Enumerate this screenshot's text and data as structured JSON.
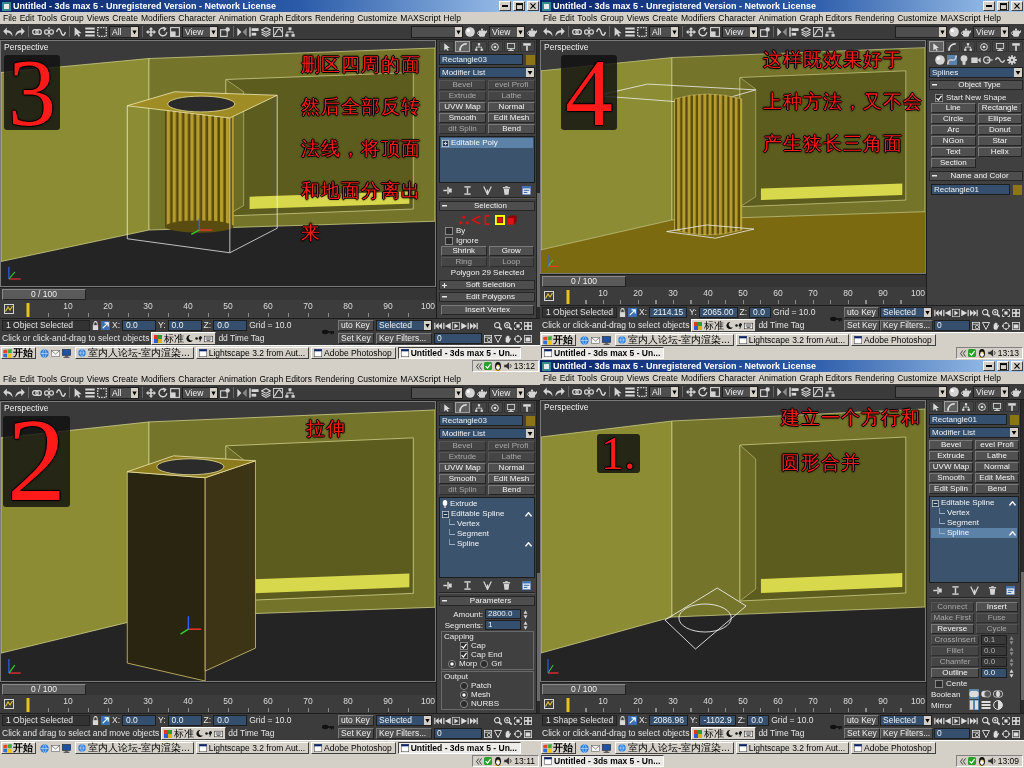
{
  "windows": [
    {
      "title": "Untitled - 3ds max 5 - Unregistered Version - Network License",
      "menu": [
        "File",
        "Edit",
        "Tools",
        "Group",
        "Views",
        "Create",
        "Modifiers",
        "Character",
        "Animation",
        "Graph Editors",
        "Rendering",
        "Customize",
        "MAXScript",
        "Help"
      ],
      "toolbar": {
        "filter": "All",
        "coordinates": "View",
        "render": "View"
      },
      "viewport": {
        "label": "Perspective",
        "kind": "shell",
        "step": "3",
        "note": [
          "删区四周的面",
          "然后全部反转",
          "法线，将顶面",
          "和地面分离出",
          "来"
        ]
      },
      "command_panel": {
        "tabs": [
          {
            "selected": false
          },
          {
            "selected": true
          },
          {
            "selected": false
          },
          {
            "selected": false
          },
          {
            "selected": false
          },
          {
            "selected": false
          }
        ],
        "sections": [
          {
            "kind": "name",
            "value": "Rectangle03",
            "color": "#8c7614"
          },
          {
            "kind": "dropdown",
            "value": "Modifier List"
          },
          {
            "kind": "buttons",
            "items": [
              {
                "label": "Bevel",
                "disabled": true
              },
              {
                "label": "evel Profi",
                "disabled": true
              },
              {
                "label": "Extrude",
                "disabled": true
              },
              {
                "label": "Lathe",
                "disabled": true
              },
              {
                "label": "UVW Map",
                "disabled": false
              },
              {
                "label": "Normal",
                "disabled": false
              },
              {
                "label": "Smooth",
                "disabled": false
              },
              {
                "label": "Edit Mesh",
                "disabled": false
              },
              {
                "label": "dit Splin",
                "disabled": true
              },
              {
                "label": "Bend",
                "disabled": false
              }
            ]
          },
          {
            "kind": "stack",
            "items": [
              {
                "label": "Editable Poly",
                "kind": "object",
                "expanded": false,
                "selected": true,
                "marked": false
              }
            ]
          },
          {
            "kind": "stack-tools"
          },
          {
            "kind": "rollout",
            "title": "Selection",
            "expanded": true,
            "items": [
              {
                "kind": "subobjects",
                "items": [
                  {
                    "selected": false
                  },
                  {
                    "selected": false
                  },
                  {
                    "selected": false
                  },
                  {
                    "selected": true
                  },
                  {
                    "selected": false
                  }
                ]
              },
              {
                "kind": "checkbox",
                "label": "By",
                "checked": false
              },
              {
                "kind": "checkbox",
                "label": "Ignore",
                "checked": false
              },
              {
                "kind": "buttons",
                "items": [
                  {
                    "label": "Shrink",
                    "disabled": false
                  },
                  {
                    "label": "Grow",
                    "disabled": false
                  },
                  {
                    "label": "Ring",
                    "disabled": true
                  },
                  {
                    "label": "Loop",
                    "disabled": true
                  }
                ]
              },
              {
                "kind": "note",
                "text": "Polygon 29 Selected"
              }
            ]
          },
          {
            "kind": "rollout",
            "title": "Soft Selection",
            "expanded": false
          },
          {
            "kind": "rollout",
            "title": "Edit Polygons",
            "expanded": true,
            "items": [
              {
                "kind": "buttons",
                "items": [
                  {
                    "label": "Insert Vertex",
                    "disabled": false
                  }
                ]
              }
            ]
          }
        ]
      },
      "timeline": {
        "frame": "0 / 100",
        "level": 0,
        "ticks": [
          "10",
          "20",
          "30",
          "40",
          "50",
          "60",
          "70",
          "80",
          "90",
          "100"
        ]
      },
      "status": {
        "selection": "1 Object Selected",
        "coordinates": [
          {
            "label": "X:",
            "value": "0.0"
          },
          {
            "label": "Y:",
            "value": "0.0"
          },
          {
            "label": "Z:",
            "value": "0.0"
          }
        ],
        "grid": "Grid = 10.0",
        "auto_key": "uto Key",
        "key_mode": "Selected",
        "prompt": "Click or click-and-drag to select objects",
        "ime": "标准",
        "time_tag": "dd Time Tag",
        "set_key": "Set Key",
        "key_filters": "Key Filters...",
        "frame": "0"
      },
      "taskbar": {
        "start": "开始",
        "buttons": [
          {
            "label": "室内人论坛-室内渲染...",
            "selected": false
          },
          {
            "label": "Lightscape 3.2 from Aut...",
            "selected": false
          },
          {
            "label": "Adobe Photoshop",
            "selected": false
          },
          {
            "label": "Untitled - 3ds max 5 - Un...",
            "selected": true
          }
        ],
        "clock": "13:12"
      }
    },
    {
      "title": "Untitled - 3ds max 5 - Unregistered Version - Network License",
      "menu": [
        "File",
        "Edit",
        "Tools",
        "Group",
        "Views",
        "Create",
        "Modifiers",
        "Character",
        "Animation",
        "Graph Editors",
        "Rendering",
        "Customize",
        "MAXScript",
        "Help"
      ],
      "toolbar": {
        "filter": "All",
        "coordinates": "View",
        "render": "View"
      },
      "viewport": {
        "label": "Perspective",
        "kind": "half-shell",
        "step": "4",
        "note": [
          "这样既效果好于",
          "上种方法，又不会",
          "产生狭长三角面"
        ]
      },
      "command_panel": {
        "tabs": [
          {
            "selected": true
          },
          {
            "selected": false
          },
          {
            "selected": false
          },
          {
            "selected": false
          },
          {
            "selected": false
          },
          {
            "selected": false
          }
        ],
        "sections": [
          {
            "kind": "categories",
            "items": [
              {
                "selected": false
              },
              {
                "selected": true
              },
              {
                "selected": false
              },
              {
                "selected": false
              },
              {
                "selected": false
              },
              {
                "selected": false
              },
              {
                "selected": false
              }
            ]
          },
          {
            "kind": "dropdown",
            "value": "Splines"
          },
          {
            "kind": "rollout",
            "title": "Object Type",
            "expanded": true,
            "items": [
              {
                "kind": "checkbox",
                "label": "Start New Shape",
                "checked": true
              },
              {
                "kind": "buttons",
                "items": [
                  {
                    "label": "Line",
                    "disabled": false
                  },
                  {
                    "label": "Rectangle",
                    "disabled": false
                  },
                  {
                    "label": "Circle",
                    "disabled": false
                  },
                  {
                    "label": "Ellipse",
                    "disabled": false
                  },
                  {
                    "label": "Arc",
                    "disabled": false
                  },
                  {
                    "label": "Donut",
                    "disabled": false
                  },
                  {
                    "label": "NGon",
                    "disabled": false
                  },
                  {
                    "label": "Star",
                    "disabled": false
                  },
                  {
                    "label": "Text",
                    "disabled": false
                  },
                  {
                    "label": "Helix",
                    "disabled": false
                  },
                  {
                    "label": "Section",
                    "disabled": false
                  }
                ]
              }
            ]
          },
          {
            "kind": "rollout",
            "title": "Name and Color",
            "expanded": true,
            "items": [
              {
                "kind": "name",
                "value": "Rectangle01",
                "color": "#8c7614"
              }
            ]
          }
        ]
      },
      "timeline": {
        "frame": "0 / 100",
        "level": 0,
        "ticks": [
          "10",
          "20",
          "30",
          "40",
          "50",
          "60",
          "70",
          "80",
          "90",
          "100"
        ]
      },
      "status": {
        "selection": "1 Object Selected",
        "coordinates": [
          {
            "label": "X:",
            "value": "2114.15"
          },
          {
            "label": "Y:",
            "value": "2065.00"
          },
          {
            "label": "Z:",
            "value": "0.0"
          }
        ],
        "grid": "Grid = 10.0",
        "auto_key": "uto Key",
        "key_mode": "Selected",
        "prompt": "Click or click-and-drag to select objects",
        "ime": "标准",
        "time_tag": "dd Time Tag",
        "set_key": "Set Key",
        "key_filters": "Key Filters...",
        "frame": "0"
      },
      "taskbar": {
        "start": "开始",
        "buttons": [
          {
            "label": "室内人论坛-室内渲染...",
            "selected": false
          },
          {
            "label": "Lightscape 3.2 from Aut...",
            "selected": false
          },
          {
            "label": "Adobe Photoshop",
            "selected": false
          },
          {
            "label": "Untitled - 3ds max 5 - Un...",
            "selected": true
          }
        ],
        "clock": "13:13"
      }
    },
    {
      "menu": [
        "File",
        "Edit",
        "Tools",
        "Group",
        "Views",
        "Create",
        "Modifiers",
        "Character",
        "Animation",
        "Graph Editors",
        "Rendering",
        "Customize",
        "MAXScript",
        "Help"
      ],
      "toolbar": {
        "filter": "All",
        "coordinates": "View",
        "render": "View"
      },
      "viewport": {
        "label": "Perspective",
        "kind": "extrude",
        "step": "2",
        "note": [
          "拉伸"
        ]
      },
      "command_panel": {
        "tabs": [
          {
            "selected": false
          },
          {
            "selected": true
          },
          {
            "selected": false
          },
          {
            "selected": false
          },
          {
            "selected": false
          },
          {
            "selected": false
          }
        ],
        "sections": [
          {
            "kind": "name",
            "value": "Rectangle03",
            "color": "#8c7614"
          },
          {
            "kind": "dropdown",
            "value": "Modifier List"
          },
          {
            "kind": "buttons",
            "items": [
              {
                "label": "Bevel",
                "disabled": true
              },
              {
                "label": "evel Profi",
                "disabled": true
              },
              {
                "label": "Extrude",
                "disabled": true
              },
              {
                "label": "Lathe",
                "disabled": true
              },
              {
                "label": "UVW Map",
                "disabled": false
              },
              {
                "label": "Normal",
                "disabled": false
              },
              {
                "label": "Smooth",
                "disabled": false
              },
              {
                "label": "Edit Mesh",
                "disabled": false
              },
              {
                "label": "dit Splin",
                "disabled": true
              },
              {
                "label": "Bend",
                "disabled": false
              }
            ]
          },
          {
            "kind": "stack",
            "items": [
              {
                "label": "Extrude",
                "kind": "modifier",
                "selected": false,
                "marked": false
              },
              {
                "label": "Editable Spline",
                "kind": "object",
                "expanded": true,
                "selected": false,
                "marked": true,
                "children": [
                  {
                    "label": "Vertex",
                    "kind": "level",
                    "selected": false,
                    "marked": false
                  },
                  {
                    "label": "Segment",
                    "kind": "level",
                    "selected": false,
                    "marked": false
                  },
                  {
                    "label": "Spline",
                    "kind": "level",
                    "selected": false,
                    "marked": true
                  }
                ]
              }
            ]
          },
          {
            "kind": "stack-tools"
          },
          {
            "kind": "rollout",
            "title": "Parameters",
            "expanded": true,
            "items": [
              {
                "kind": "field",
                "label": "Amount:",
                "value": "2800.0"
              },
              {
                "kind": "field",
                "label": "Segments:",
                "value": "1"
              },
              {
                "kind": "group",
                "title": "Capping",
                "items": [
                  {
                    "kind": "checkbox",
                    "label": "Cap",
                    "checked": true
                  },
                  {
                    "kind": "checkbox",
                    "label": "Cap End",
                    "checked": true
                  },
                  {
                    "kind": "radios",
                    "items": [
                      {
                        "label": "Morp",
                        "selected": true
                      },
                      {
                        "label": "Gri",
                        "selected": false
                      }
                    ]
                  }
                ]
              },
              {
                "kind": "group",
                "title": "Output",
                "items": [
                  {
                    "kind": "radio",
                    "label": "Patch",
                    "selected": false
                  },
                  {
                    "kind": "radio",
                    "label": "Mesh",
                    "selected": true
                  },
                  {
                    "kind": "radio",
                    "label": "NURBS",
                    "selected": false
                  }
                ]
              }
            ]
          }
        ]
      },
      "timeline": {
        "frame": "0 / 100",
        "level": 0,
        "ticks": [
          "10",
          "20",
          "30",
          "40",
          "50",
          "60",
          "70",
          "80",
          "90",
          "100"
        ]
      },
      "status": {
        "selection": "1 Object Selected",
        "coordinates": [
          {
            "label": "X:",
            "value": "0.0"
          },
          {
            "label": "Y:",
            "value": "0.0"
          },
          {
            "label": "Z:",
            "value": "0.0"
          }
        ],
        "grid": "Grid = 10.0",
        "auto_key": "uto Key",
        "key_mode": "Selected",
        "prompt": "Click and drag to select and move objects",
        "ime": "标准",
        "time_tag": "dd Time Tag",
        "set_key": "Set Key",
        "key_filters": "Key Filters...",
        "frame": "0"
      },
      "taskbar": {
        "start": "开始",
        "buttons": [
          {
            "label": "室内人论坛-室内渲染...",
            "selected": false
          },
          {
            "label": "Lightscape 3.2 from Aut...",
            "selected": false
          },
          {
            "label": "Adobe Photoshop",
            "selected": false
          },
          {
            "label": "Untitled - 3ds max 5 - Un...",
            "selected": true
          }
        ],
        "clock": "13:11"
      }
    },
    {
      "title": "Untitled - 3ds max 5 - Unregistered Version - Network License",
      "menu": [
        "File",
        "Edit",
        "Tools",
        "Group",
        "Views",
        "Create",
        "Modifiers",
        "Character",
        "Animation",
        "Graph Editors",
        "Rendering",
        "Customize",
        "MAXScript",
        "Help"
      ],
      "toolbar": {
        "filter": "All",
        "coordinates": "View",
        "render": "View"
      },
      "viewport": {
        "label": "Perspective",
        "kind": "shape",
        "step": "1.",
        "note": [
          "建立一个方行和",
          "圆形合并"
        ]
      },
      "command_panel": {
        "tabs": [
          {
            "selected": false
          },
          {
            "selected": true
          },
          {
            "selected": false
          },
          {
            "selected": false
          },
          {
            "selected": false
          },
          {
            "selected": false
          }
        ],
        "sections": [
          {
            "kind": "name",
            "value": "Rectangle01",
            "color": "#8c7614"
          },
          {
            "kind": "dropdown",
            "value": "Modifier List"
          },
          {
            "kind": "buttons",
            "items": [
              {
                "label": "Bevel",
                "disabled": false
              },
              {
                "label": "evel Profi",
                "disabled": false
              },
              {
                "label": "Extrude",
                "disabled": false
              },
              {
                "label": "Lathe",
                "disabled": false
              },
              {
                "label": "UVW Map",
                "disabled": false
              },
              {
                "label": "Normal",
                "disabled": false
              },
              {
                "label": "Smooth",
                "disabled": false
              },
              {
                "label": "Edit Mesh",
                "disabled": false
              },
              {
                "label": "Edit Splin",
                "disabled": false
              },
              {
                "label": "Bend",
                "disabled": false
              }
            ]
          },
          {
            "kind": "stack",
            "items": [
              {
                "label": "Editable Spline",
                "kind": "object",
                "expanded": true,
                "selected": false,
                "marked": true,
                "children": [
                  {
                    "label": "Vertex",
                    "kind": "level",
                    "selected": false,
                    "marked": false
                  },
                  {
                    "label": "Segment",
                    "kind": "level",
                    "selected": false,
                    "marked": false
                  },
                  {
                    "label": "Spline",
                    "kind": "level",
                    "selected": true,
                    "marked": true
                  }
                ]
              }
            ]
          },
          {
            "kind": "stack-tools"
          },
          {
            "kind": "controls",
            "items": [
              {
                "kind": "buttons",
                "items": [
                  {
                    "label": "Connect",
                    "disabled": true
                  },
                  {
                    "label": "Insert",
                    "disabled": false
                  },
                  {
                    "label": "Make First",
                    "disabled": true
                  },
                  {
                    "label": "Fuse",
                    "disabled": true
                  },
                  {
                    "label": "Reverse",
                    "disabled": false
                  },
                  {
                    "label": "Cycle",
                    "disabled": true
                  }
                ]
              },
              {
                "kind": "spinner",
                "label": "CrossInsert",
                "value": "0.1",
                "disabled": true
              },
              {
                "kind": "spinner",
                "label": "Fillet",
                "value": "0.0",
                "disabled": true
              },
              {
                "kind": "spinner",
                "label": "Chamfer",
                "value": "0.0",
                "disabled": true
              },
              {
                "kind": "spinner",
                "label": "Outline",
                "value": "0.0",
                "disabled": false
              },
              {
                "kind": "checkbox",
                "label": "Cente",
                "checked": false
              },
              {
                "kind": "options",
                "label": "Boolean",
                "items": [
                  {
                    "selected": true
                  },
                  {
                    "selected": false
                  },
                  {
                    "selected": false
                  }
                ]
              },
              {
                "kind": "options",
                "label": "Mirror",
                "items": [
                  {
                    "selected": true
                  },
                  {
                    "selected": false
                  },
                  {
                    "selected": false
                  }
                ]
              }
            ]
          }
        ]
      },
      "timeline": {
        "frame": "0 / 100",
        "level": 0,
        "ticks": [
          "10",
          "20",
          "30",
          "40",
          "50",
          "60",
          "70",
          "80",
          "90",
          "100"
        ]
      },
      "status": {
        "selection": "1 Shape Selected",
        "coordinates": [
          {
            "label": "X:",
            "value": "2086.96"
          },
          {
            "label": "Y:",
            "value": "-1102.9"
          },
          {
            "label": "Z:",
            "value": "0.0"
          }
        ],
        "grid": "Grid = 10.0",
        "auto_key": "uto Key",
        "key_mode": "Selected",
        "prompt": "Click or click-and-drag to select objects",
        "ime": "标准",
        "time_tag": "dd Time Tag",
        "set_key": "Set Key",
        "key_filters": "Key Filters...",
        "frame": "0"
      },
      "taskbar": {
        "start": "开始",
        "buttons": [
          {
            "label": "室内人论坛-室内渲染...",
            "selected": false
          },
          {
            "label": "Lightscape 3.2 from Aut...",
            "selected": false
          },
          {
            "label": "Adobe Photoshop",
            "selected": false
          },
          {
            "label": "Untitled - 3ds max 5 - Un...",
            "selected": true
          }
        ],
        "clock": "13:09"
      }
    }
  ]
}
